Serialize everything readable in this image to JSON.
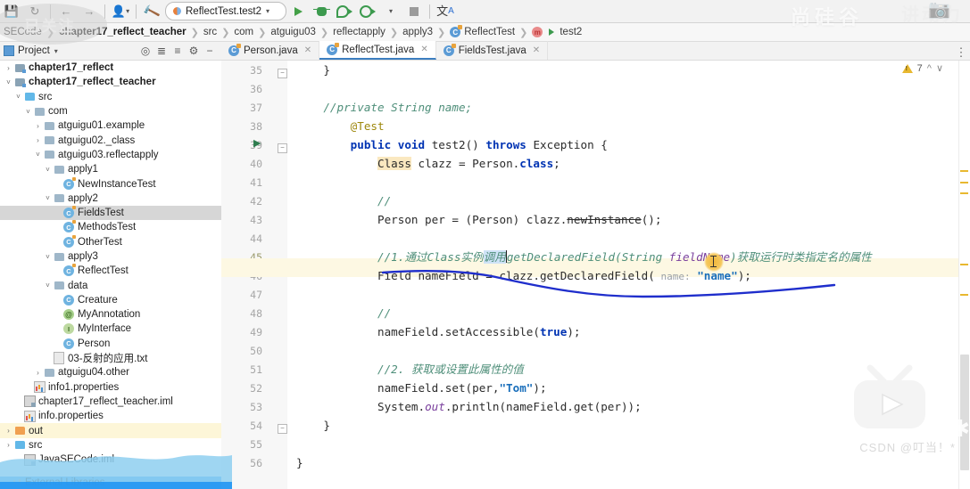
{
  "toolbar": {
    "run_config": "ReflectTest.test2",
    "icons": [
      "save-icon",
      "sync-icon",
      "back-arrow-icon",
      "forward-arrow-icon",
      "user-icon",
      "build-hammer-icon",
      "run-icon",
      "debug-icon",
      "run-coverage-icon",
      "profile-icon",
      "stop-icon",
      "translate-icon"
    ]
  },
  "breadcrumb": {
    "items": [
      {
        "label": "SECode",
        "bold": false,
        "icon": ""
      },
      {
        "label": "chapter17_reflect_teacher",
        "bold": true,
        "icon": ""
      },
      {
        "label": "src",
        "bold": false,
        "icon": ""
      },
      {
        "label": "com",
        "bold": false,
        "icon": ""
      },
      {
        "label": "atguigu03",
        "bold": false,
        "icon": ""
      },
      {
        "label": "reflectapply",
        "bold": false,
        "icon": ""
      },
      {
        "label": "apply3",
        "bold": false,
        "icon": ""
      },
      {
        "label": "ReflectTest",
        "bold": false,
        "icon": "class-icon"
      },
      {
        "label": "test2",
        "bold": false,
        "icon": "method-icon"
      }
    ]
  },
  "project_panel": {
    "title": "Project",
    "tree": [
      {
        "indent": 0,
        "arrow": "collapsed",
        "icon": "module-folder",
        "label": "chapter17_reflect",
        "bold": true,
        "state": ""
      },
      {
        "indent": 0,
        "arrow": "expanded",
        "icon": "module-folder",
        "label": "chapter17_reflect_teacher",
        "bold": true,
        "state": ""
      },
      {
        "indent": 1,
        "arrow": "expanded",
        "icon": "source-folder",
        "label": "src",
        "bold": false,
        "state": ""
      },
      {
        "indent": 2,
        "arrow": "expanded",
        "icon": "package",
        "label": "com",
        "bold": false,
        "state": ""
      },
      {
        "indent": 3,
        "arrow": "collapsed",
        "icon": "package",
        "label": "atguigu01.example",
        "bold": false,
        "state": ""
      },
      {
        "indent": 3,
        "arrow": "collapsed",
        "icon": "package",
        "label": "atguigu02._class",
        "bold": false,
        "state": ""
      },
      {
        "indent": 3,
        "arrow": "expanded",
        "icon": "package",
        "label": "atguigu03.reflectapply",
        "bold": false,
        "state": ""
      },
      {
        "indent": 4,
        "arrow": "expanded",
        "icon": "package",
        "label": "apply1",
        "bold": false,
        "state": ""
      },
      {
        "indent": 5,
        "arrow": "none",
        "icon": "class",
        "label": "NewInstanceTest",
        "bold": false,
        "state": ""
      },
      {
        "indent": 4,
        "arrow": "expanded",
        "icon": "package",
        "label": "apply2",
        "bold": false,
        "state": ""
      },
      {
        "indent": 5,
        "arrow": "none",
        "icon": "class",
        "label": "FieldsTest",
        "bold": false,
        "state": "selected"
      },
      {
        "indent": 5,
        "arrow": "none",
        "icon": "class",
        "label": "MethodsTest",
        "bold": false,
        "state": ""
      },
      {
        "indent": 5,
        "arrow": "none",
        "icon": "class",
        "label": "OtherTest",
        "bold": false,
        "state": ""
      },
      {
        "indent": 4,
        "arrow": "expanded",
        "icon": "package",
        "label": "apply3",
        "bold": false,
        "state": ""
      },
      {
        "indent": 5,
        "arrow": "none",
        "icon": "class",
        "label": "ReflectTest",
        "bold": false,
        "state": ""
      },
      {
        "indent": 4,
        "arrow": "expanded",
        "icon": "package",
        "label": "data",
        "bold": false,
        "state": ""
      },
      {
        "indent": 5,
        "arrow": "none",
        "icon": "class-plain",
        "label": "Creature",
        "bold": false,
        "state": ""
      },
      {
        "indent": 5,
        "arrow": "none",
        "icon": "annotation",
        "label": "MyAnnotation",
        "bold": false,
        "state": ""
      },
      {
        "indent": 5,
        "arrow": "none",
        "icon": "interface",
        "label": "MyInterface",
        "bold": false,
        "state": ""
      },
      {
        "indent": 5,
        "arrow": "none",
        "icon": "class-plain",
        "label": "Person",
        "bold": false,
        "state": ""
      },
      {
        "indent": 4,
        "arrow": "none",
        "icon": "textfile",
        "label": "03-反射的应用.txt",
        "bold": false,
        "state": ""
      },
      {
        "indent": 3,
        "arrow": "collapsed",
        "icon": "package",
        "label": "atguigu04.other",
        "bold": false,
        "state": ""
      },
      {
        "indent": 2,
        "arrow": "none",
        "icon": "properties",
        "label": "info1.properties",
        "bold": false,
        "state": ""
      },
      {
        "indent": 1,
        "arrow": "none",
        "icon": "iml",
        "label": "chapter17_reflect_teacher.iml",
        "bold": false,
        "state": ""
      },
      {
        "indent": 1,
        "arrow": "none",
        "icon": "properties",
        "label": "info.properties",
        "bold": false,
        "state": ""
      },
      {
        "indent": 0,
        "arrow": "collapsed",
        "icon": "out-folder",
        "label": "out",
        "bold": false,
        "state": "highlight"
      },
      {
        "indent": 0,
        "arrow": "collapsed",
        "icon": "source-folder",
        "label": "src",
        "bold": false,
        "state": ""
      },
      {
        "indent": 1,
        "arrow": "none",
        "icon": "iml",
        "label": "JavaSECode.iml",
        "bold": false,
        "state": ""
      }
    ],
    "external_libraries": "External Libraries"
  },
  "editor": {
    "tabs": [
      {
        "label": "Person.java",
        "active": false
      },
      {
        "label": "ReflectTest.java",
        "active": true
      },
      {
        "label": "FieldsTest.java",
        "active": false
      }
    ],
    "warning_count": "7",
    "first_line_number": 35,
    "current_line_number": 45,
    "lines": [
      {
        "n": 35,
        "text": "    }"
      },
      {
        "n": 36,
        "text": ""
      },
      {
        "n": 37,
        "text": "    //private String name;"
      },
      {
        "n": 38,
        "text": "    @Test"
      },
      {
        "n": 39,
        "text": "    public void test2() throws Exception {"
      },
      {
        "n": 40,
        "text": "        Class clazz = Person.class;"
      },
      {
        "n": 41,
        "text": ""
      },
      {
        "n": 42,
        "text": "        //"
      },
      {
        "n": 43,
        "text": "        Person per = (Person) clazz.newInstance();"
      },
      {
        "n": 44,
        "text": ""
      },
      {
        "n": 45,
        "text": "        //1.通过Class实例调用getDeclaredField(String fieldName)获取运行时类指定名的属性"
      },
      {
        "n": 46,
        "text": "        Field nameField = clazz.getDeclaredField( name: \"name\");"
      },
      {
        "n": 47,
        "text": ""
      },
      {
        "n": 48,
        "text": "        //"
      },
      {
        "n": 49,
        "text": "        nameField.setAccessible(true);"
      },
      {
        "n": 50,
        "text": ""
      },
      {
        "n": 51,
        "text": "        //2. 获取或设置此属性的值"
      },
      {
        "n": 52,
        "text": "        nameField.set(per,\"Tom\");"
      },
      {
        "n": 53,
        "text": "        System.out.println(nameField.get(per));"
      },
      {
        "n": 54,
        "text": "    }"
      },
      {
        "n": 55,
        "text": ""
      },
      {
        "n": 56,
        "text": "}"
      }
    ]
  },
  "overlays": {
    "follow_badge": "已关注",
    "brand_watermark": "尚硅谷",
    "brand_watermark2": "讲动力",
    "csdn_credit": "CSDN @叮当！*"
  },
  "colors": {
    "accent_blue": "#3c7ec0",
    "keyword": "#0033b3",
    "comment": "#4f8f7a",
    "string": "#1a6fbb",
    "annotation": "#9e880d",
    "warning": "#e8b830",
    "selection": "#cfe3f7",
    "current_line": "#fdf8e3",
    "tree_selected": "#d6d6d6"
  }
}
